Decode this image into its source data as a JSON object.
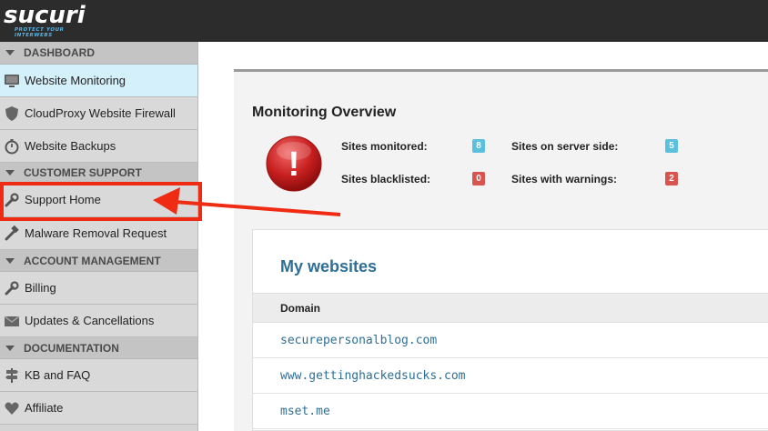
{
  "brand": {
    "logo_text": "sucuri",
    "tagline": "PROTECT YOUR INTERWEBS"
  },
  "sidebar": {
    "sections": [
      {
        "header": "DASHBOARD",
        "items": [
          {
            "label": "Website Monitoring",
            "icon": "monitor-icon",
            "active": true
          },
          {
            "label": "CloudProxy Website Firewall",
            "icon": "shield-icon"
          },
          {
            "label": "Website Backups",
            "icon": "stopwatch-icon"
          }
        ]
      },
      {
        "header": "CUSTOMER SUPPORT",
        "items": [
          {
            "label": "Support Home",
            "icon": "wrench-icon"
          },
          {
            "label": "Malware Removal Request",
            "icon": "hammer-icon"
          }
        ]
      },
      {
        "header": "ACCOUNT MANAGEMENT",
        "items": [
          {
            "label": "Billing",
            "icon": "wrench-icon"
          },
          {
            "label": "Updates & Cancellations",
            "icon": "envelope-icon"
          }
        ]
      },
      {
        "header": "DOCUMENTATION",
        "items": [
          {
            "label": "KB and FAQ",
            "icon": "signpost-icon"
          },
          {
            "label": "Affiliate",
            "icon": "heart-icon"
          }
        ]
      }
    ]
  },
  "overview": {
    "title": "Monitoring Overview",
    "stats": {
      "sites_monitored_label": "Sites monitored:",
      "sites_monitored_value": "8",
      "sites_server_side_label": "Sites on server side:",
      "sites_server_side_value": "5",
      "sites_blacklisted_label": "Sites blacklisted:",
      "sites_blacklisted_value": "0",
      "sites_warnings_label": "Sites with warnings:",
      "sites_warnings_value": "2"
    },
    "alert_glyph": "!"
  },
  "websites": {
    "title": "My websites",
    "column_header": "Domain",
    "rows": [
      "securepersonalblog.com",
      "www.gettinghackedsucks.com",
      "mset.me"
    ]
  },
  "colors": {
    "accent_blue": "#2d6f95",
    "badge_blue": "#5bc0de",
    "badge_red": "#d9534f",
    "annotation_red": "#f02b14"
  }
}
